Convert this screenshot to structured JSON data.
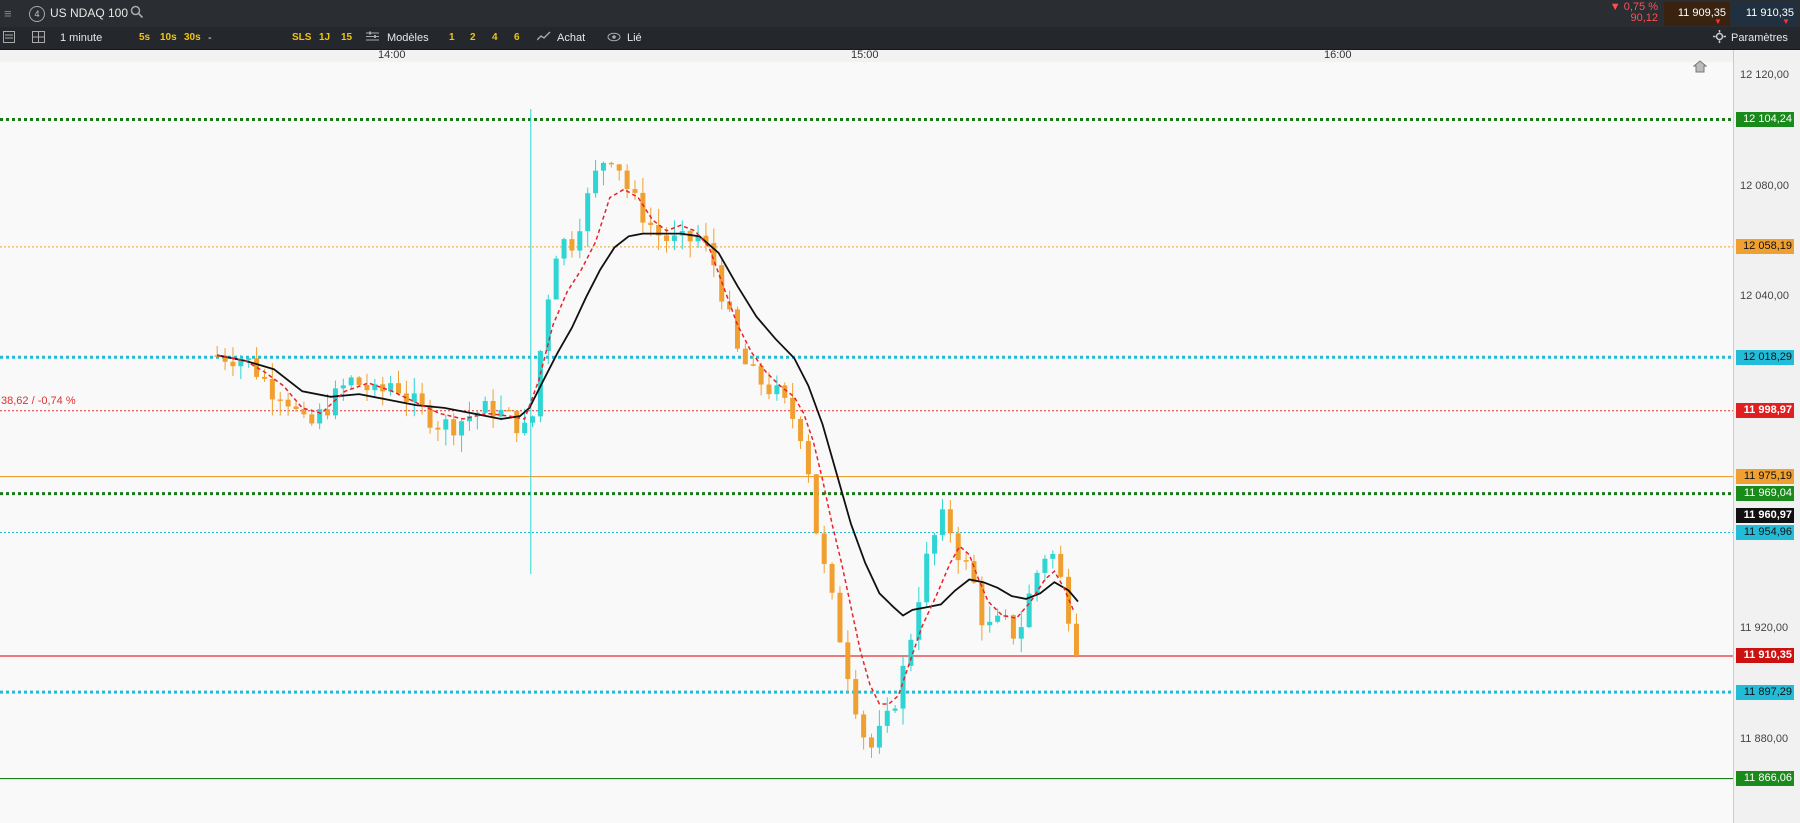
{
  "header": {
    "menu_icon": "hamburger-icon",
    "index_badge": "4",
    "instrument": "US NDAQ 100",
    "search_icon": "search-icon",
    "change_pct": "▼ 0,75 %",
    "change_abs": "90,12",
    "sell_price": "11 909,35",
    "buy_price": "11 910,35"
  },
  "toolbar": {
    "timeframe": "1 minute",
    "intervals": [
      "5s",
      "10s",
      "30s"
    ],
    "dash": "-",
    "chips": [
      "SLS",
      "1J",
      "15"
    ],
    "models_label": "Modèles",
    "layouts": [
      "1",
      "2",
      "4",
      "6"
    ],
    "buy_label": "Achat",
    "linked_label": "Lié",
    "settings_label": "Paramètres"
  },
  "time_axis": [
    "14:00",
    "15:00",
    "16:00"
  ],
  "annotation": "38,62 / -0,74 %",
  "colors": {
    "up": "#2fd5d2",
    "down": "#f0a030",
    "ma_fast": "#e8222a",
    "ma_slow": "#111111",
    "level_green": "#1a7a1a",
    "level_cyan": "#22bcd8",
    "level_orange": "#f0a030",
    "level_red": "#e03030"
  },
  "chart_data": {
    "type": "candlestick",
    "instrument": "US NDAQ 100",
    "timeframe": "1 minute",
    "x_ticks": [
      "14:00",
      "15:00",
      "16:00"
    ],
    "y_ticks": [
      "12 120,00",
      "12 080,00",
      "12 040,00",
      "11 920,00",
      "11 880,00"
    ],
    "ylim": [
      11850,
      12125
    ],
    "price_levels": [
      {
        "label": "12 104,24",
        "value": 12104.24,
        "style": "dotted-thick",
        "color": "#1a7a1a",
        "tag_bg": "#1a8a1a"
      },
      {
        "label": "12 058,19",
        "value": 12058.19,
        "style": "dotted",
        "color": "#f0a030",
        "tag_bg": "#f0a030"
      },
      {
        "label": "12 018,29",
        "value": 12018.29,
        "style": "dotted-thick",
        "color": "#22bcd8",
        "tag_bg": "#22bcd8"
      },
      {
        "label": "11 998,97",
        "value": 11998.97,
        "style": "dotted",
        "color": "#e03030",
        "tag_bg": "#e02020"
      },
      {
        "label": "11 975,19",
        "value": 11975.19,
        "style": "solid",
        "color": "#f0a030",
        "tag_bg": "#f0a030"
      },
      {
        "label": "11 969,04",
        "value": 11969.04,
        "style": "dotted-thick",
        "color": "#1a7a1a",
        "tag_bg": "#1a8a1a"
      },
      {
        "label": "11 960,97",
        "value": 11960.97,
        "style": "none",
        "color": "#111111",
        "tag_bg": "#111111"
      },
      {
        "label": "11 954,96",
        "value": 11954.96,
        "style": "dotted",
        "color": "#22bcd8",
        "tag_bg": "#22bcd8"
      },
      {
        "label": "11 910,35",
        "value": 11910.35,
        "style": "solid",
        "color": "#e03030",
        "tag_bg": "#cc1111"
      },
      {
        "label": "11 897,29",
        "value": 11897.29,
        "style": "dotted-thick",
        "color": "#22bcd8",
        "tag_bg": "#22bcd8"
      },
      {
        "label": "11 866,06",
        "value": 11866.06,
        "style": "solid",
        "color": "#1a7a1a",
        "tag_bg": "#1a8a1a"
      }
    ],
    "close_path": [
      [
        13.66,
        12019
      ],
      [
        13.72,
        12018
      ],
      [
        13.75,
        12012
      ],
      [
        13.78,
        12006
      ],
      [
        13.8,
        12006
      ],
      [
        13.82,
        12000
      ],
      [
        13.85,
        11992
      ],
      [
        13.88,
        11998
      ],
      [
        13.91,
        12004
      ],
      [
        13.94,
        12010
      ],
      [
        13.97,
        12008
      ],
      [
        14.0,
        12004
      ],
      [
        14.03,
        12010
      ],
      [
        14.06,
        12004
      ],
      [
        14.1,
        11998
      ],
      [
        14.13,
        11994
      ],
      [
        14.16,
        11994
      ],
      [
        14.2,
        11998
      ],
      [
        14.24,
        12000
      ],
      [
        14.28,
        11996
      ],
      [
        14.31,
        11992
      ],
      [
        14.33,
        11998
      ],
      [
        14.35,
        12032
      ],
      [
        14.38,
        12060
      ],
      [
        14.41,
        12060
      ],
      [
        14.44,
        12074
      ],
      [
        14.47,
        12089
      ],
      [
        14.5,
        12092
      ],
      [
        14.53,
        12078
      ],
      [
        14.56,
        12070
      ],
      [
        14.59,
        12063
      ],
      [
        14.62,
        12060
      ],
      [
        14.65,
        12060
      ],
      [
        14.68,
        12062
      ],
      [
        14.71,
        12052
      ],
      [
        14.74,
        12034
      ],
      [
        14.76,
        12020
      ],
      [
        14.79,
        12012
      ],
      [
        14.82,
        12008
      ],
      [
        14.85,
        12004
      ],
      [
        14.87,
        11998
      ],
      [
        14.89,
        11994
      ],
      [
        14.91,
        11978
      ],
      [
        14.92,
        11962
      ],
      [
        14.94,
        11944
      ],
      [
        14.96,
        11930
      ],
      [
        14.98,
        11915
      ],
      [
        15.0,
        11900
      ],
      [
        15.01,
        11893
      ],
      [
        15.03,
        11880
      ],
      [
        15.05,
        11876
      ],
      [
        15.06,
        11882
      ],
      [
        15.08,
        11888
      ],
      [
        15.1,
        11898
      ],
      [
        15.12,
        11912
      ],
      [
        15.14,
        11930
      ],
      [
        15.16,
        11945
      ],
      [
        15.18,
        11955
      ],
      [
        15.2,
        11962
      ],
      [
        15.22,
        11950
      ],
      [
        15.24,
        11944
      ],
      [
        15.26,
        11936
      ],
      [
        15.28,
        11922
      ],
      [
        15.3,
        11920
      ],
      [
        15.32,
        11924
      ],
      [
        15.34,
        11918
      ],
      [
        15.36,
        11922
      ],
      [
        15.38,
        11934
      ],
      [
        15.4,
        11944
      ],
      [
        15.42,
        11950
      ],
      [
        15.44,
        11940
      ],
      [
        15.46,
        11926
      ],
      [
        15.48,
        11912
      ]
    ],
    "ma_fast_path": [
      [
        13.66,
        12019
      ],
      [
        13.72,
        12017
      ],
      [
        13.76,
        12013
      ],
      [
        13.8,
        12008
      ],
      [
        13.84,
        12000
      ],
      [
        13.88,
        11998
      ],
      [
        13.93,
        12006
      ],
      [
        13.98,
        12009
      ],
      [
        14.03,
        12006
      ],
      [
        14.08,
        12002
      ],
      [
        14.13,
        11998
      ],
      [
        14.18,
        11996
      ],
      [
        14.23,
        11998
      ],
      [
        14.28,
        11997
      ],
      [
        14.31,
        11996
      ],
      [
        14.34,
        12010
      ],
      [
        14.37,
        12030
      ],
      [
        14.4,
        12042
      ],
      [
        14.43,
        12050
      ],
      [
        14.46,
        12060
      ],
      [
        14.49,
        12076
      ],
      [
        14.52,
        12079
      ],
      [
        14.55,
        12076
      ],
      [
        14.58,
        12068
      ],
      [
        14.61,
        12064
      ],
      [
        14.64,
        12066
      ],
      [
        14.67,
        12064
      ],
      [
        14.7,
        12058
      ],
      [
        14.73,
        12044
      ],
      [
        14.76,
        12030
      ],
      [
        14.79,
        12020
      ],
      [
        14.82,
        12013
      ],
      [
        14.85,
        12008
      ],
      [
        14.88,
        12004
      ],
      [
        14.9,
        11998
      ],
      [
        14.92,
        11988
      ],
      [
        14.94,
        11974
      ],
      [
        14.96,
        11958
      ],
      [
        14.98,
        11944
      ],
      [
        15.0,
        11928
      ],
      [
        15.02,
        11912
      ],
      [
        15.04,
        11900
      ],
      [
        15.06,
        11893
      ],
      [
        15.08,
        11893
      ],
      [
        15.1,
        11896
      ],
      [
        15.12,
        11906
      ],
      [
        15.15,
        11921
      ],
      [
        15.18,
        11932
      ],
      [
        15.21,
        11944
      ],
      [
        15.23,
        11950
      ],
      [
        15.25,
        11947
      ],
      [
        15.27,
        11938
      ],
      [
        15.29,
        11930
      ],
      [
        15.32,
        11925
      ],
      [
        15.35,
        11924
      ],
      [
        15.38,
        11930
      ],
      [
        15.41,
        11938
      ],
      [
        15.43,
        11941
      ],
      [
        15.45,
        11935
      ],
      [
        15.47,
        11927
      ]
    ],
    "ma_slow_path": [
      [
        13.66,
        12019
      ],
      [
        13.72,
        12017
      ],
      [
        13.78,
        12014
      ],
      [
        13.84,
        12006
      ],
      [
        13.9,
        12004
      ],
      [
        13.96,
        12005
      ],
      [
        14.02,
        12003
      ],
      [
        14.08,
        12001
      ],
      [
        14.14,
        12000
      ],
      [
        14.2,
        11998
      ],
      [
        14.26,
        11996
      ],
      [
        14.3,
        11997
      ],
      [
        14.32,
        12000
      ],
      [
        14.35,
        12010
      ],
      [
        14.38,
        12020
      ],
      [
        14.41,
        12029
      ],
      [
        14.44,
        12040
      ],
      [
        14.47,
        12050
      ],
      [
        14.5,
        12058
      ],
      [
        14.53,
        12062
      ],
      [
        14.56,
        12063
      ],
      [
        14.6,
        12063
      ],
      [
        14.64,
        12063
      ],
      [
        14.68,
        12062
      ],
      [
        14.72,
        12056
      ],
      [
        14.76,
        12044
      ],
      [
        14.8,
        12033
      ],
      [
        14.84,
        12025
      ],
      [
        14.88,
        12018
      ],
      [
        14.91,
        12008
      ],
      [
        14.94,
        11994
      ],
      [
        14.97,
        11976
      ],
      [
        15.0,
        11958
      ],
      [
        15.03,
        11944
      ],
      [
        15.06,
        11933
      ],
      [
        15.09,
        11928
      ],
      [
        15.11,
        11925
      ],
      [
        15.13,
        11927
      ],
      [
        15.16,
        11928
      ],
      [
        15.19,
        11929
      ],
      [
        15.22,
        11934
      ],
      [
        15.25,
        11938
      ],
      [
        15.28,
        11937
      ],
      [
        15.31,
        11935
      ],
      [
        15.34,
        11932
      ],
      [
        15.37,
        11931
      ],
      [
        15.4,
        11933
      ],
      [
        15.43,
        11937
      ],
      [
        15.46,
        11934
      ],
      [
        15.48,
        11930
      ]
    ]
  }
}
